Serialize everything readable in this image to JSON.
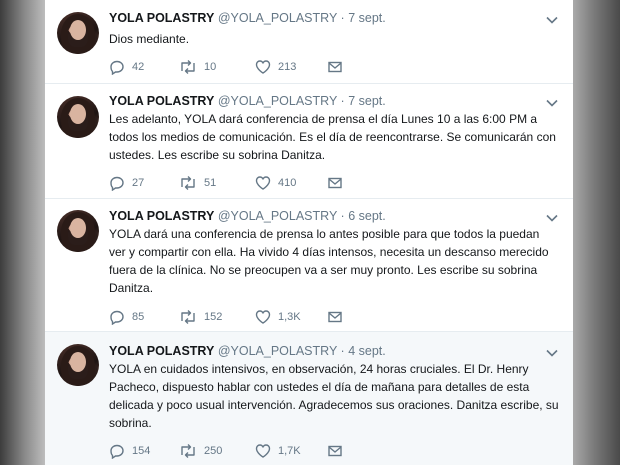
{
  "icons": {
    "reply": "reply-icon",
    "retweet": "retweet-icon",
    "like": "heart-icon",
    "dm": "mail-icon",
    "menu": "chevron-down-icon"
  },
  "colors": {
    "name": "#14171a",
    "secondary": "#657786",
    "divider": "#e6ecf0",
    "highlight_bg": "#f5f8fa"
  },
  "tweets": [
    {
      "name": "YOLA POLASTRY",
      "handle": "@YOLA_POLASTRY",
      "separator": "·",
      "date": "7 sept.",
      "text": "Dios mediante.",
      "replies": "42",
      "retweets": "10",
      "likes": "213"
    },
    {
      "name": "YOLA POLASTRY",
      "handle": "@YOLA_POLASTRY",
      "separator": "·",
      "date": "7 sept.",
      "text": "Les adelanto, YOLA dará conferencia de prensa el día Lunes 10 a las 6:00 PM a todos los medios de comunicación. Es el día de reencontrarse. Se comunicarán con ustedes. Les escribe su sobrina Danitza.",
      "replies": "27",
      "retweets": "51",
      "likes": "410"
    },
    {
      "name": "YOLA POLASTRY",
      "handle": "@YOLA_POLASTRY",
      "separator": "·",
      "date": "6 sept.",
      "text": "YOLA dará una conferencia de prensa lo antes posible para que todos la puedan ver y compartir con ella. Ha vivido 4 días intensos, necesita un descanso merecido fuera de la clínica. No se preocupen va a ser muy pronto. Les escribe su sobrina Danitza.",
      "replies": "85",
      "retweets": "152",
      "likes": "1,3K"
    },
    {
      "name": "YOLA POLASTRY",
      "handle": "@YOLA_POLASTRY",
      "separator": "·",
      "date": "4 sept.",
      "text": "YOLA en cuidados intensivos, en observación, 24 horas cruciales. El Dr. Henry Pacheco, dispuesto hablar con ustedes el día de mañana para detalles de esta delicada y poco usual intervención. Agradecemos sus oraciones. Danitza escribe, su sobrina.",
      "replies": "154",
      "retweets": "250",
      "likes": "1,7K"
    }
  ]
}
